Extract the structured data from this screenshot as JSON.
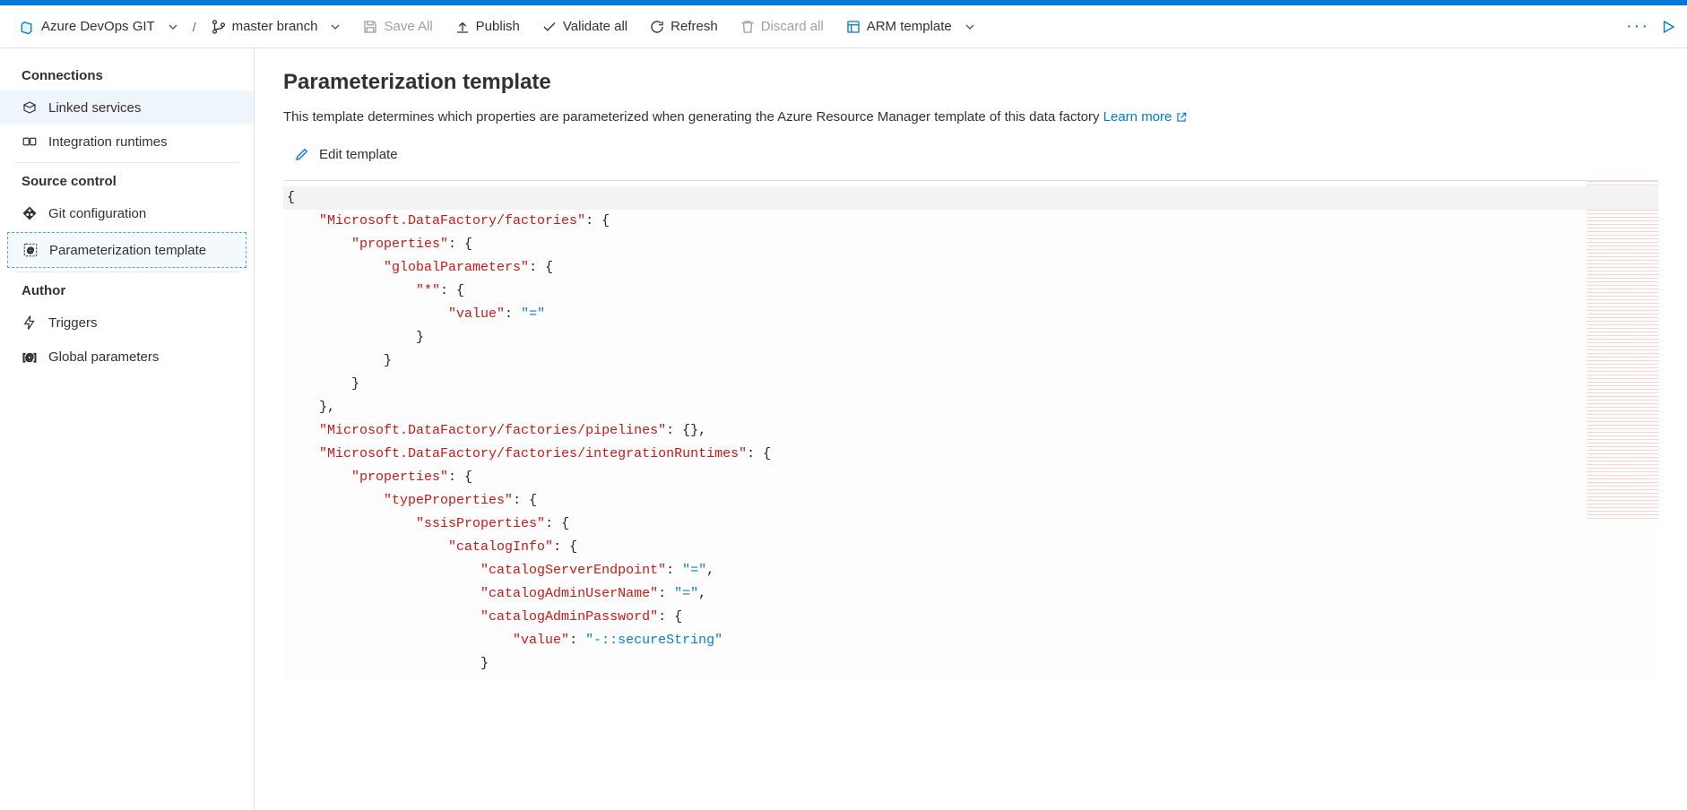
{
  "toolbar": {
    "repo_label": "Azure DevOps GIT",
    "branch_label": "master branch",
    "save_all": "Save All",
    "publish": "Publish",
    "validate_all": "Validate all",
    "refresh": "Refresh",
    "discard_all": "Discard all",
    "arm_template": "ARM template"
  },
  "sidebar": {
    "section_connections": "Connections",
    "linked_services": "Linked services",
    "integration_runtimes": "Integration runtimes",
    "section_source_control": "Source control",
    "git_configuration": "Git configuration",
    "parameterization_template": "Parameterization template",
    "section_author": "Author",
    "triggers": "Triggers",
    "global_parameters": "Global parameters"
  },
  "page": {
    "title": "Parameterization template",
    "description": "This template determines which properties are parameterized when generating the Azure Resource Manager template of this data factory ",
    "learn_more": "Learn more",
    "edit_template": "Edit template"
  },
  "code": {
    "l1": "{",
    "k_factories": "\"Microsoft.DataFactory/factories\"",
    "k_properties": "\"properties\"",
    "k_globalParameters": "\"globalParameters\"",
    "k_star": "\"*\"",
    "k_value": "\"value\"",
    "v_equals": "\"=\"",
    "k_pipelines": "\"Microsoft.DataFactory/factories/pipelines\"",
    "v_empty_obj": "{}",
    "k_integrationRuntimes": "\"Microsoft.DataFactory/factories/integrationRuntimes\"",
    "k_typeProperties": "\"typeProperties\"",
    "k_ssisProperties": "\"ssisProperties\"",
    "k_catalogInfo": "\"catalogInfo\"",
    "k_catalogServerEndpoint": "\"catalogServerEndpoint\"",
    "k_catalogAdminUserName": "\"catalogAdminUserName\"",
    "k_catalogAdminPassword": "\"catalogAdminPassword\"",
    "v_secureString": "\"-::secureString\""
  }
}
